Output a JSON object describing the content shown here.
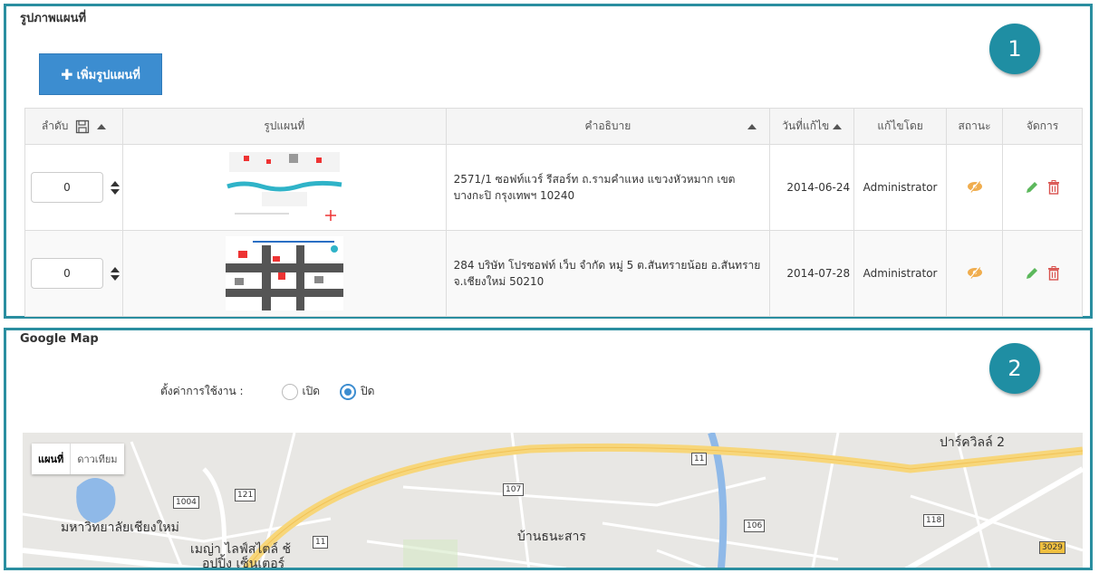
{
  "panel1": {
    "title": "รูปภาพแผนที่",
    "badge": "1",
    "add_button_label": "เพิ่มรูปแผนที่",
    "table": {
      "headers": {
        "order": "ลำดับ",
        "image": "รูปแผนที่",
        "description": "คำอธิบาย",
        "date": "วันที่แก้ไข",
        "by": "แก้ไขโดย",
        "status": "สถานะ",
        "manage": "จัดการ"
      },
      "rows": [
        {
          "order": "0",
          "description": "2571/1 ซอฟท์แวร์ รีสอร์ท ถ.รามคำแหง แขวงหัวหมาก เขตบางกะปิ กรุงเทพฯ 10240",
          "date": "2014-06-24",
          "by": "Administrator"
        },
        {
          "order": "0",
          "description": "284 บริษัท โปรซอฟท์ เว็บ จำกัด หมู่ 5 ต.สันทรายน้อย อ.สันทราย จ.เชียงใหม่ 50210",
          "date": "2014-07-28",
          "by": "Administrator"
        }
      ]
    }
  },
  "panel2": {
    "title": "Google Map",
    "badge": "2",
    "setting_label": "ตั้งค่าการใช้งาน :",
    "option_on": "เปิด",
    "option_off": "ปิด",
    "selected_option": "ปิด",
    "map": {
      "type_map": "แผนที่",
      "type_satellite": "ดาวเทียม",
      "labels": {
        "park_villa": "ปาร์ควิลล์ 2",
        "university": "มหาวิทยาลัยเชียงใหม่",
        "ban_thanasan": "บ้านธนะสาร",
        "maya": "เมญ่า ไลฟ์สไตล์ ช้",
        "central": "อปปิ้ง เซ็นเตอร์"
      },
      "road_numbers": [
        "1004",
        "121",
        "107",
        "11",
        "106",
        "118",
        "11",
        "3029"
      ]
    }
  },
  "colors": {
    "frame": "#2a8ea0",
    "badge": "#1f8ea3",
    "button": "#3c8dd0",
    "edit_icon": "#5cb85c",
    "delete_icon": "#d9534f",
    "status_icon": "#f0ad4e"
  }
}
